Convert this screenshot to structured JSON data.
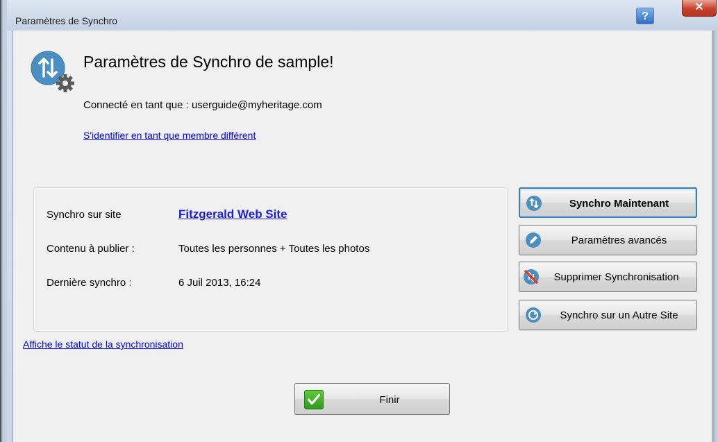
{
  "window": {
    "title": "Paramètres de Synchro",
    "help_label": "?",
    "close_label": "✕"
  },
  "header": {
    "title": "Paramètres de Synchro de sample!",
    "connected_text": "Connecté en tant que : userguide@myheritage.com",
    "switch_member_link": "S'identifier en tant que membre différent",
    "icon": "sync-settings-icon"
  },
  "info": {
    "rows": [
      {
        "label": "Synchro sur site",
        "value": "Fitzgerald Web Site"
      },
      {
        "label": "Contenu à publier :",
        "value": "Toutes les personnes + Toutes les photos"
      },
      {
        "label": "Dernière synchro :",
        "value": "6 Juil 2013, 16:24"
      }
    ]
  },
  "actions": [
    {
      "label": "Synchro Maintenant",
      "icon": "sync-now-icon"
    },
    {
      "label": "Paramètres avancés",
      "icon": "pencil-icon"
    },
    {
      "label": "Supprimer Synchronisation",
      "icon": "delete-sync-icon"
    },
    {
      "label": "Synchro sur un Autre Site",
      "icon": "globe-icon"
    }
  ],
  "status_link": "Affiche le statut de la synchronisation",
  "finish": {
    "label": "Finir",
    "icon": "checkmark-icon"
  },
  "colors": {
    "link": "#0000ee",
    "accent": "#3c7fb1",
    "icon_blue": "#4a8fbf"
  }
}
